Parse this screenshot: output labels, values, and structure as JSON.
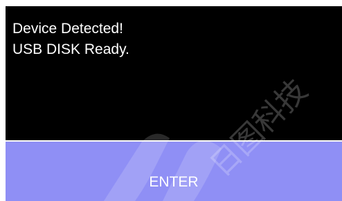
{
  "dialog": {
    "message_lines": [
      "Device Detected!",
      "USB DISK Ready."
    ],
    "enter_label": "ENTER"
  },
  "watermark": {
    "text": "日图科技"
  },
  "colors": {
    "background": "#000000",
    "button": "#8f8ff5",
    "text": "#ffffff"
  }
}
